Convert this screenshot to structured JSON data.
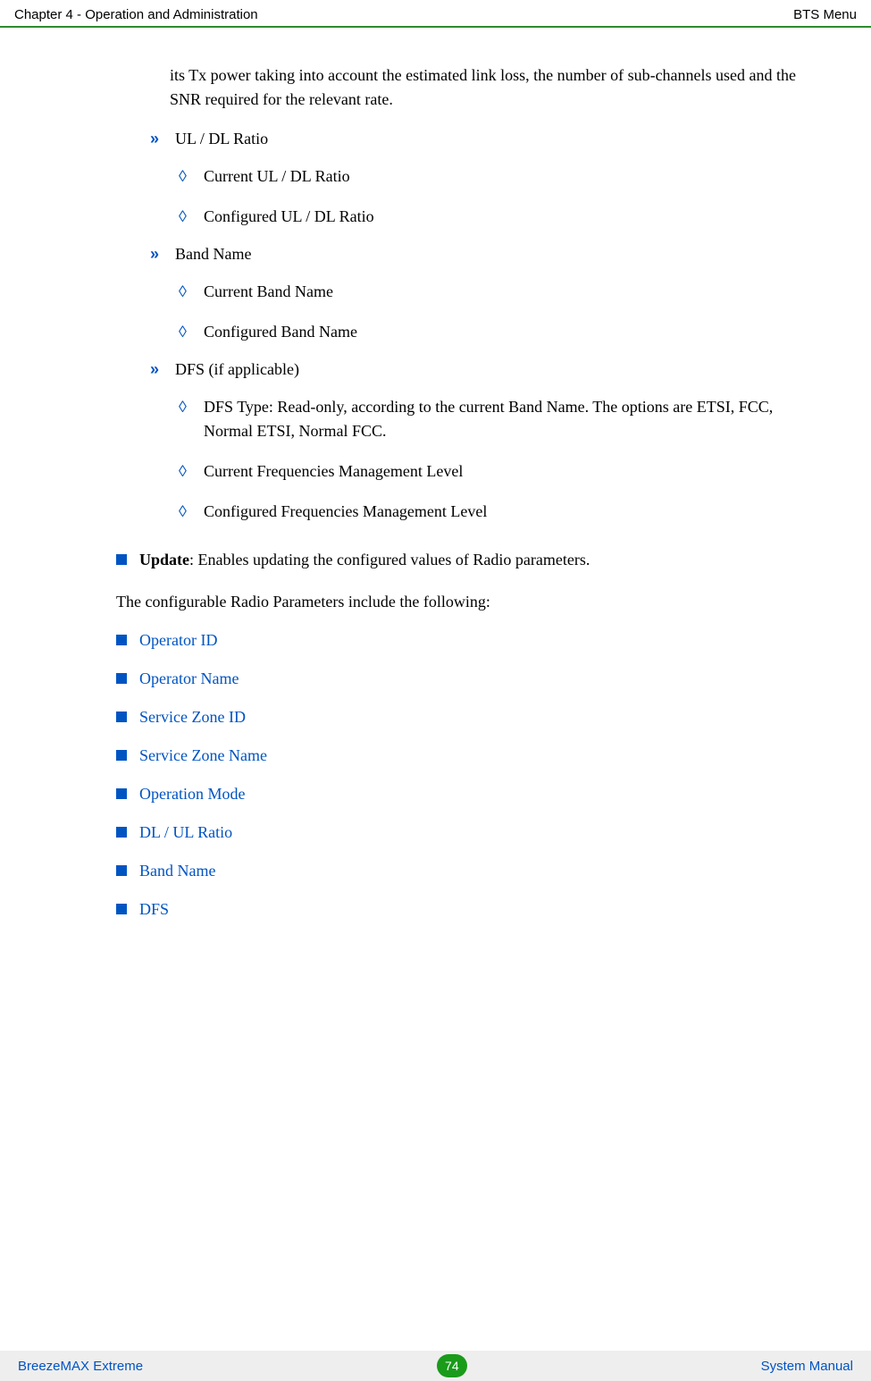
{
  "header": {
    "left": "Chapter 4 - Operation and Administration",
    "right": "BTS Menu"
  },
  "intro": "its Tx power taking into account the estimated link loss, the number of sub-channels used and the SNR required for the relevant rate.",
  "sections": {
    "ul_dl": {
      "title": "UL / DL Ratio",
      "items": [
        "Current UL / DL Ratio",
        "Configured UL / DL Ratio"
      ]
    },
    "band": {
      "title": "Band Name",
      "items": [
        "Current Band Name",
        "Configured Band Name"
      ]
    },
    "dfs": {
      "title": "DFS (if applicable)",
      "items": [
        "DFS Type: Read-only, according to the current Band Name. The options are ETSI, FCC, Normal ETSI, Normal FCC.",
        "Current Frequencies Management Level",
        "Configured Frequencies Management Level"
      ]
    }
  },
  "update": {
    "label": "Update",
    "text": ": Enables updating the configured values of Radio parameters."
  },
  "post": "The configurable Radio Parameters include the following:",
  "links": [
    "Operator ID",
    "Operator Name",
    "Service Zone ID",
    "Service Zone Name",
    "Operation Mode",
    "DL / UL Ratio",
    "Band Name",
    "DFS"
  ],
  "footer": {
    "left": "BreezeMAX Extreme",
    "page": "74",
    "right": "System Manual"
  }
}
